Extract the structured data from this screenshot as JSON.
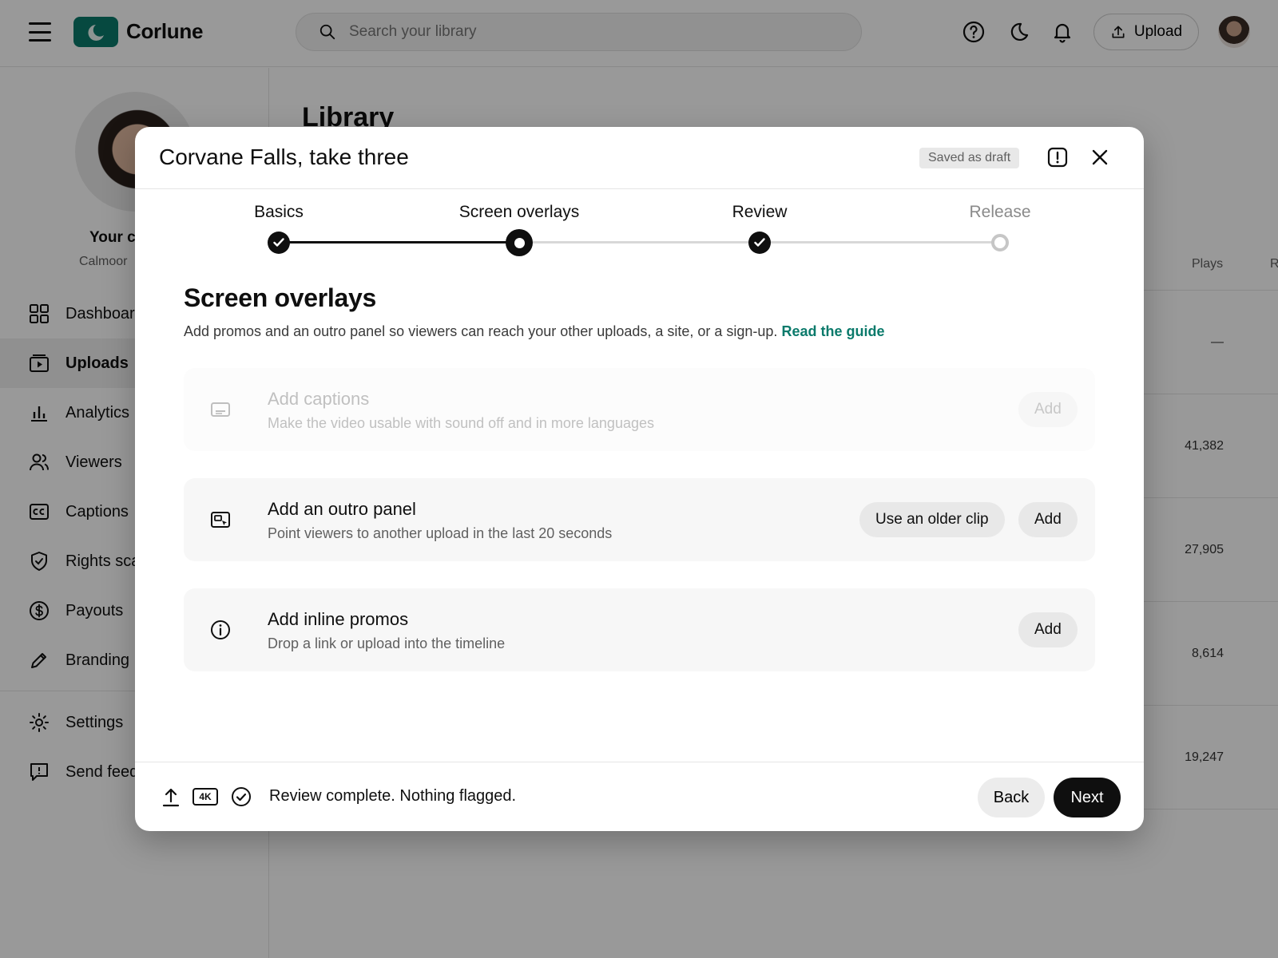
{
  "app": {
    "brand": "Corlune",
    "search_placeholder": "Search your library",
    "upload_label": "Upload"
  },
  "sidebar": {
    "channel_name": "Your c",
    "channel_sub": "Calmoor",
    "items": [
      {
        "label": "Dashboard",
        "icon": "grid-icon"
      },
      {
        "label": "Uploads",
        "icon": "video-icon",
        "active": true
      },
      {
        "label": "Analytics",
        "icon": "bar-chart-icon"
      },
      {
        "label": "Viewers",
        "icon": "people-icon"
      },
      {
        "label": "Captions",
        "icon": "cc-icon"
      },
      {
        "label": "Rights sca",
        "icon": "shield-icon"
      },
      {
        "label": "Payouts",
        "icon": "dollar-icon"
      },
      {
        "label": "Branding",
        "icon": "pencil-icon"
      },
      {
        "label": "Settings",
        "icon": "gear-icon"
      },
      {
        "label": "Send feed",
        "icon": "feedback-icon"
      }
    ]
  },
  "library": {
    "title": "Library",
    "columns": [
      "Plays",
      "R"
    ],
    "plays": [
      "—",
      "41,382",
      "27,905",
      "8,614",
      "19,247"
    ]
  },
  "modal": {
    "title": "Corvane Falls, take three",
    "draft_badge": "Saved as draft",
    "steps": [
      {
        "label": "Basics",
        "state": "done"
      },
      {
        "label": "Screen overlays",
        "state": "current"
      },
      {
        "label": "Review",
        "state": "done"
      },
      {
        "label": "Release",
        "state": "pending"
      }
    ],
    "section_title": "Screen overlays",
    "section_desc": "Add promos and an outro panel so viewers can reach your other uploads, a site, or a sign-up.",
    "guide_link": "Read the guide",
    "cards": [
      {
        "title": "Add captions",
        "sub": "Make the video usable with sound off and in more languages",
        "add_label": "Add",
        "disabled": true
      },
      {
        "title": "Add an outro panel",
        "sub": "Point viewers to another upload in the last 20 seconds",
        "alt_label": "Use an older clip",
        "add_label": "Add"
      },
      {
        "title": "Add inline promos",
        "sub": "Drop a link or upload into the timeline",
        "add_label": "Add"
      }
    ],
    "footer": {
      "quality_badge": "4K",
      "status": "Review complete. Nothing flagged.",
      "back_label": "Back",
      "next_label": "Next"
    }
  },
  "colors": {
    "accent": "#0b7a6b",
    "primary": "#0f0f0f",
    "muted": "#606060"
  }
}
